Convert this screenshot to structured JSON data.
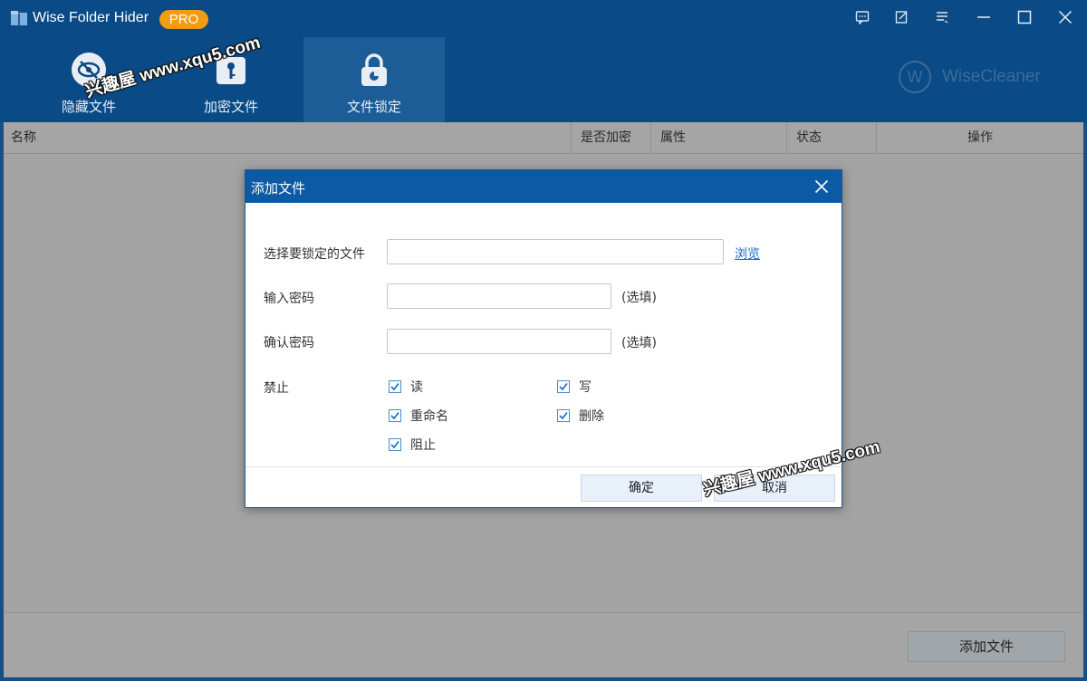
{
  "app": {
    "title": "Wise Folder Hider",
    "badge": "PRO",
    "brand": "WiseCleaner",
    "brand_logo_letter": "W"
  },
  "titlebar_icons": [
    "feedback-icon",
    "edit-icon",
    "menu-icon",
    "minimize-icon",
    "maximize-icon",
    "close-icon"
  ],
  "tabs": [
    {
      "label": "隐藏文件",
      "icon": "eye-slash-icon",
      "active": false
    },
    {
      "label": "加密文件",
      "icon": "key-lock-icon",
      "active": false
    },
    {
      "label": "文件锁定",
      "icon": "padlock-icon",
      "active": true
    }
  ],
  "table": {
    "columns": [
      "名称",
      "是否加密",
      "属性",
      "状态",
      "操作"
    ]
  },
  "footer": {
    "add_file_label": "添加文件"
  },
  "dialog": {
    "title": "添加文件",
    "file_label": "选择要锁定的文件",
    "file_value": "",
    "browse_label": "浏览",
    "password_label": "输入密码",
    "password_value": "",
    "confirm_label": "确认密码",
    "confirm_value": "",
    "optional_label": "(选填)",
    "forbid_label": "禁止",
    "options": [
      {
        "label": "读",
        "checked": true
      },
      {
        "label": "写",
        "checked": true
      },
      {
        "label": "重命名",
        "checked": true
      },
      {
        "label": "删除",
        "checked": true
      },
      {
        "label": "阻止",
        "checked": true
      }
    ],
    "ok_label": "确定",
    "cancel_label": "取消"
  },
  "watermark": "兴趣屋 www.xqu5.com",
  "colors": {
    "header_bg": "#0a4a86",
    "active_tab": "#1c5d98",
    "badge": "#f39c12",
    "dialog_title": "#0b5aa3",
    "link": "#1569c7"
  }
}
